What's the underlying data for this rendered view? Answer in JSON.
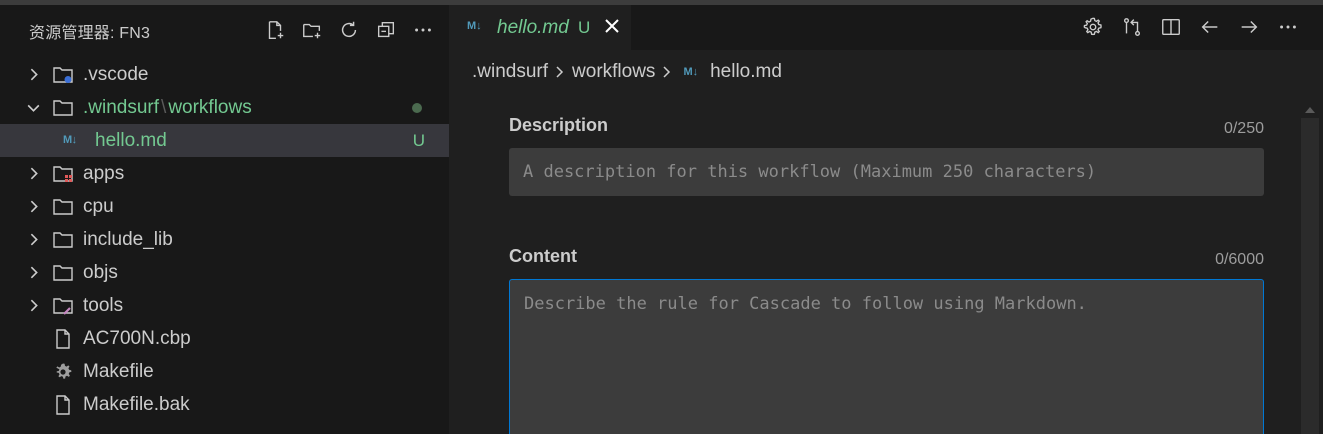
{
  "sidebar": {
    "title": "资源管理器: FN3",
    "actions": [
      {
        "name": "new-file-icon"
      },
      {
        "name": "new-folder-icon"
      },
      {
        "name": "refresh-icon"
      },
      {
        "name": "collapse-all-icon"
      },
      {
        "name": "more-icon"
      }
    ],
    "tree": [
      {
        "label": ".vscode",
        "type": "folder",
        "icon": "folder-vscode-icon"
      },
      {
        "label_a": ".windsurf",
        "label_sep": "\\",
        "label_b": "workflows",
        "type": "folder-open",
        "icon": "folder-icon"
      },
      {
        "label": "hello.md",
        "type": "file",
        "icon": "markdown-icon",
        "badge": "M↓",
        "git": "U"
      },
      {
        "label": "apps",
        "type": "folder",
        "icon": "folder-apps-icon"
      },
      {
        "label": "cpu",
        "type": "folder",
        "icon": "folder-icon"
      },
      {
        "label": "include_lib",
        "type": "folder",
        "icon": "folder-icon"
      },
      {
        "label": "objs",
        "type": "folder",
        "icon": "folder-icon"
      },
      {
        "label": "tools",
        "type": "folder",
        "icon": "folder-tools-icon"
      },
      {
        "label": "AC700N.cbp",
        "type": "file",
        "icon": "file-icon"
      },
      {
        "label": "Makefile",
        "type": "file",
        "icon": "gear-icon"
      },
      {
        "label": "Makefile.bak",
        "type": "file",
        "icon": "file-icon"
      }
    ]
  },
  "editor": {
    "tab": {
      "badge": "M↓",
      "label": "hello.md",
      "git": "U"
    },
    "breadcrumb": [
      ".windsurf",
      "workflows",
      "hello.md"
    ],
    "breadcrumb_badge": "M↓",
    "form": {
      "description_label": "Description",
      "description_count": "0/250",
      "description_placeholder": "A description for this workflow (Maximum 250 characters)",
      "content_label": "Content",
      "content_count": "0/6000",
      "content_placeholder": "Describe the rule for Cascade to follow using Markdown."
    }
  },
  "colors": {
    "accent": "#0078d4",
    "git_untracked": "#73c991",
    "markdown_icon": "#519aba",
    "sidebar_bg": "#181818",
    "editor_bg": "#1f1f1f",
    "input_bg": "#3c3c3c"
  }
}
